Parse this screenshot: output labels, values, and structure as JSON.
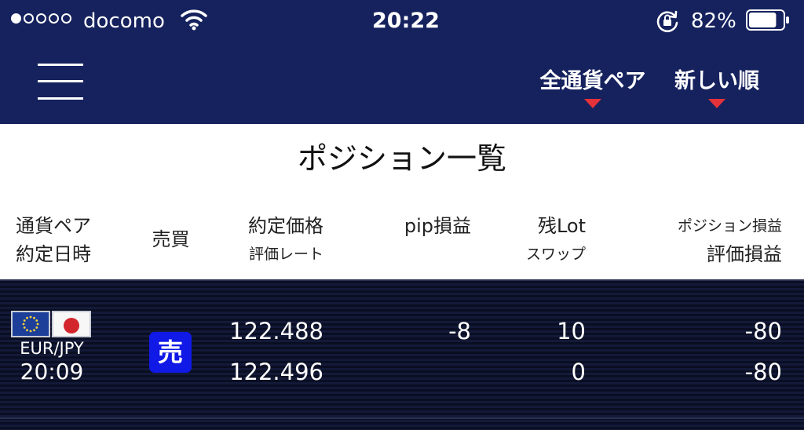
{
  "status_bar": {
    "carrier": "docomo",
    "signal_bars_filled": 1,
    "signal_bars_total": 5,
    "time": "20:22",
    "battery_percent": "82%",
    "battery_level": 0.82
  },
  "nav": {
    "menu_icon": "hamburger-menu-icon",
    "pair_filter_label": "全通貨ペア",
    "sort_filter_label": "新しい順"
  },
  "page": {
    "title": "ポジション一覧"
  },
  "columns": {
    "pair": "通貨ペア",
    "contract_time": "約定日時",
    "side": "売買",
    "contract_price": "約定価格",
    "rate": "評価レート",
    "pip_pl": "pip損益",
    "lot": "残Lot",
    "swap": "スワップ",
    "position_pl": "ポジション損益",
    "eval_pl": "評価損益"
  },
  "positions": [
    {
      "pair": "EUR/JPY",
      "time": "20:09",
      "side": "売",
      "contract_price": "122.488",
      "rate": "122.496",
      "pip_pl": "-8",
      "lot": "10",
      "swap": "0",
      "position_pl": "-80",
      "eval_pl": "-80"
    }
  ],
  "colors": {
    "header_bg": "#16225e",
    "row_bg": "#0b0f26",
    "sell_badge": "#1019e6",
    "dropdown_triangle": "#e4323a"
  }
}
